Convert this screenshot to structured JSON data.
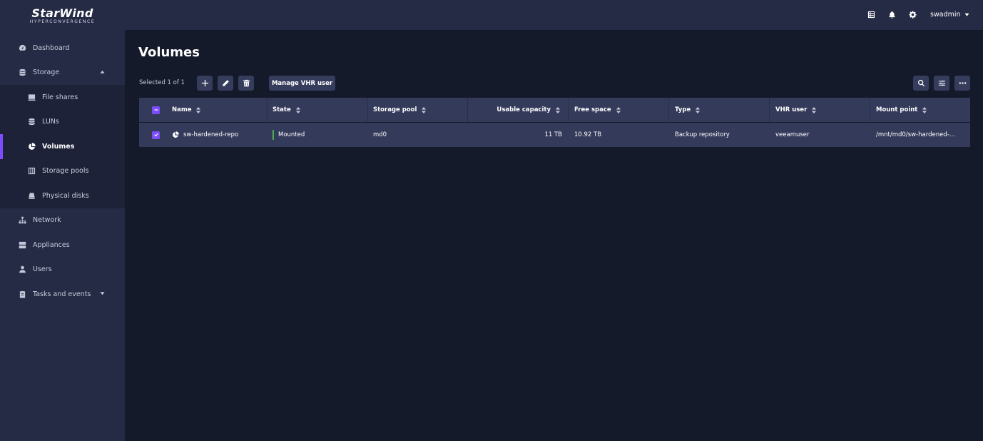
{
  "app": {
    "logo_main": "StarWind",
    "logo_sub": "HYPERCONVERGENCE"
  },
  "sidebar": {
    "items": [
      {
        "label": "Dashboard",
        "icon": "dashboard-icon"
      },
      {
        "label": "Storage",
        "icon": "storage-icon"
      },
      {
        "label": "File shares",
        "icon": "file-shares-icon"
      },
      {
        "label": "LUNs",
        "icon": "luns-icon"
      },
      {
        "label": "Volumes",
        "icon": "volumes-icon"
      },
      {
        "label": "Storage pools",
        "icon": "storage-pools-icon"
      },
      {
        "label": "Physical disks",
        "icon": "physical-disks-icon"
      },
      {
        "label": "Network",
        "icon": "network-icon"
      },
      {
        "label": "Appliances",
        "icon": "appliances-icon"
      },
      {
        "label": "Users",
        "icon": "users-icon"
      },
      {
        "label": "Tasks and events",
        "icon": "tasks-icon"
      }
    ]
  },
  "topbar": {
    "username": "swadmin"
  },
  "main": {
    "title": "Volumes",
    "selected_text": "Selected 1 of 1",
    "manage_button": "Manage VHR user"
  },
  "table": {
    "columns": [
      "Name",
      "State",
      "Storage pool",
      "Usable capacity",
      "Free space",
      "Type",
      "VHR user",
      "Mount point"
    ],
    "rows": [
      {
        "name": "sw-hardened-repo",
        "state": "Mounted",
        "storage_pool": "md0",
        "usable_capacity": "11 TB",
        "free_space": "10.92 TB",
        "type": "Backup repository",
        "vhr_user": "veeamuser",
        "mount_point": "/mnt/md0/sw-hardened-..."
      }
    ]
  },
  "colors": {
    "accent": "#7c4dff",
    "sidebar_bg": "#252a45",
    "page_bg": "#151a2b",
    "table_bg": "#343a5a",
    "state_ok": "#4caf50"
  }
}
